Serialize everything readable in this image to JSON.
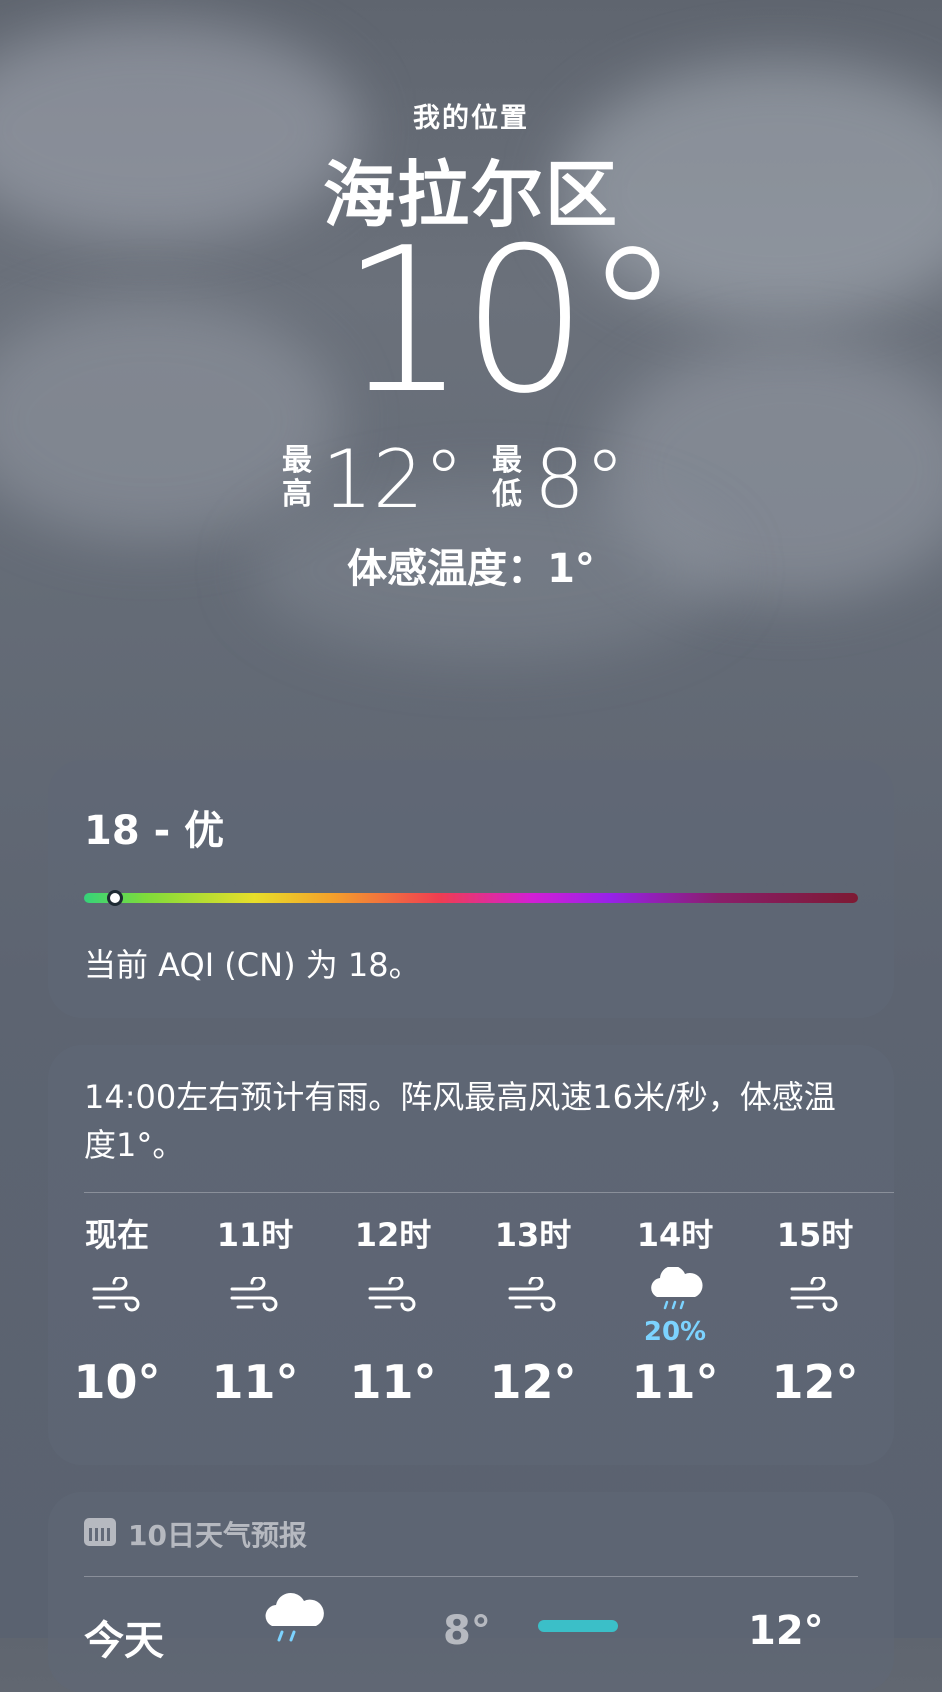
{
  "location": {
    "label": "我的位置",
    "city": "海拉尔区"
  },
  "current": {
    "temp": "10°",
    "high_label": "最高",
    "high": "12°",
    "low_label": "最低",
    "low": "8°",
    "feels_like": "体感温度：1°"
  },
  "aqi": {
    "title": "18 - 优",
    "description": "当前 AQI (CN) 为 18。",
    "level_fraction": 0.04
  },
  "hourly": {
    "summary": "14:00左右预计有雨。阵风最高风速16米/秒，体感温度1°。",
    "hours": [
      {
        "label": "现在",
        "icon": "wind-icon",
        "temp": "10°"
      },
      {
        "label": "11时",
        "icon": "wind-icon",
        "temp": "11°"
      },
      {
        "label": "12时",
        "icon": "wind-icon",
        "temp": "11°"
      },
      {
        "label": "13时",
        "icon": "wind-icon",
        "temp": "12°"
      },
      {
        "label": "14时",
        "icon": "rain-cloud-icon",
        "pop": "20%",
        "temp": "11°"
      },
      {
        "label": "15时",
        "icon": "wind-icon",
        "temp": "12°"
      }
    ]
  },
  "ten_day": {
    "title": "10日天气预报",
    "today": {
      "day": "今天",
      "icon": "rain-cloud-icon",
      "low": "8°",
      "high": "12°"
    }
  },
  "colors": {
    "precip_blue": "#7cd3ff",
    "temp_bar": "#3bbfc8"
  }
}
